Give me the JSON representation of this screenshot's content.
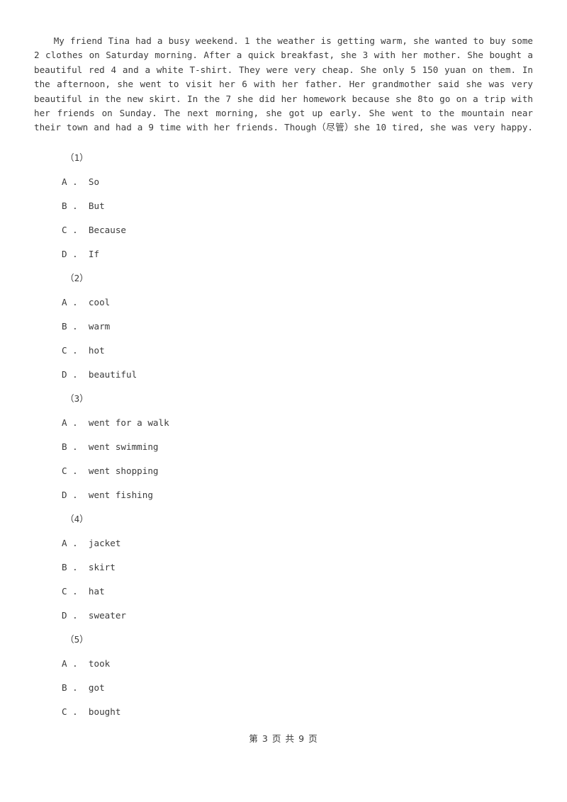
{
  "document": {
    "page_background": "#ffffff",
    "text_color": "#3b3b3b"
  },
  "passage": {
    "text": "My friend Tina had a busy weekend. 1 the weather is getting warm, she wanted to buy some 2 clothes on Saturday morning. After a quick breakfast, she 3 with her mother. She bought a beautiful red 4 and a white T-shirt. They were very cheap. She only 5 150 yuan on them. In the afternoon, she went to visit her 6 with her father. Her grandmother said she was very beautiful in the new skirt. In the 7 she did her homework because she 8to go on a trip with her friends on Sunday. The next morning, she got up early. She went to the mountain near their town and had a 9 time with her friends. Though（尽管）she 10 tired, she was very happy."
  },
  "questions": [
    {
      "number": "（1）",
      "options": [
        {
          "letter": "A .",
          "text": "So"
        },
        {
          "letter": "B .",
          "text": "But"
        },
        {
          "letter": "C .",
          "text": "Because"
        },
        {
          "letter": "D .",
          "text": "If"
        }
      ]
    },
    {
      "number": "（2）",
      "options": [
        {
          "letter": "A .",
          "text": "cool"
        },
        {
          "letter": "B .",
          "text": "warm"
        },
        {
          "letter": "C .",
          "text": "hot"
        },
        {
          "letter": "D .",
          "text": "beautiful"
        }
      ]
    },
    {
      "number": "（3）",
      "options": [
        {
          "letter": "A .",
          "text": "went for a walk"
        },
        {
          "letter": "B .",
          "text": "went swimming"
        },
        {
          "letter": "C .",
          "text": "went shopping"
        },
        {
          "letter": "D .",
          "text": "went fishing"
        }
      ]
    },
    {
      "number": "（4）",
      "options": [
        {
          "letter": "A .",
          "text": "jacket"
        },
        {
          "letter": "B .",
          "text": "skirt"
        },
        {
          "letter": "C .",
          "text": "hat"
        },
        {
          "letter": "D .",
          "text": "sweater"
        }
      ]
    },
    {
      "number": "（5）",
      "options": [
        {
          "letter": "A .",
          "text": "took"
        },
        {
          "letter": "B .",
          "text": "got"
        },
        {
          "letter": "C .",
          "text": "bought"
        }
      ]
    }
  ],
  "footer": {
    "text": "第 3 页 共 9 页",
    "current_page": "3",
    "total_pages": "9"
  }
}
